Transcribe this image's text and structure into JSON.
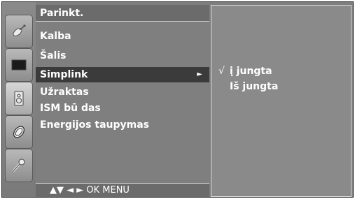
{
  "menu": {
    "title": "Parinkt.",
    "items": [
      {
        "label": "Kalba",
        "selected": false
      },
      {
        "label": "Šalis",
        "selected": false
      },
      {
        "label": "Simplink",
        "selected": true,
        "arrow": "►"
      },
      {
        "label": "Užraktas",
        "selected": false
      },
      {
        "label": "ISM bū das",
        "selected": false
      },
      {
        "label": "Energijos taupymas",
        "selected": false
      }
    ],
    "nav_hint": "▲▼  ◄ ►  OK  MENU"
  },
  "submenu": {
    "items": [
      {
        "label": "į jungta",
        "checked": true,
        "check_mark": "√"
      },
      {
        "label": "Iš jungta",
        "checked": false,
        "check_mark": ""
      }
    ]
  },
  "sidebar": {
    "icons": [
      {
        "name": "satellite-dish-icon"
      },
      {
        "name": "tv-screen-icon"
      },
      {
        "name": "speaker-icon"
      },
      {
        "name": "clock-icon"
      },
      {
        "name": "option-key-icon"
      }
    ]
  },
  "colors": {
    "background": "#7e7e7e",
    "selected_row": "#3b3b3b",
    "text": "#ffffff"
  }
}
